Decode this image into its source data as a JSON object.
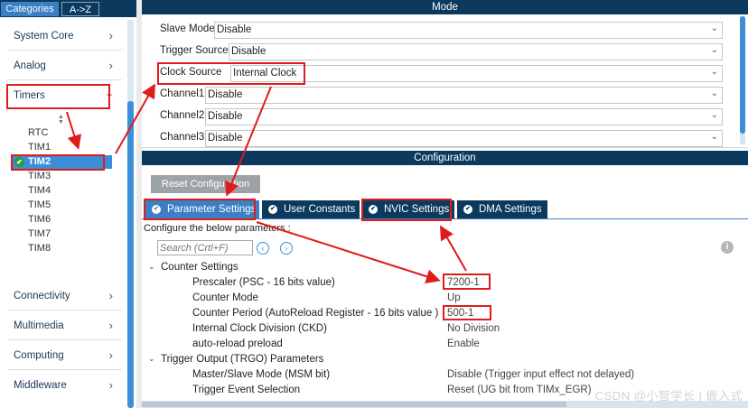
{
  "categories_tabs": {
    "active": "Categories",
    "other": "A->Z"
  },
  "categories": [
    {
      "label": "System Core",
      "expanded": false
    },
    {
      "label": "Analog",
      "expanded": false
    },
    {
      "label": "Timers",
      "expanded": true
    },
    {
      "label": "Connectivity",
      "expanded": false
    },
    {
      "label": "Multimedia",
      "expanded": false
    },
    {
      "label": "Computing",
      "expanded": false
    },
    {
      "label": "Middleware",
      "expanded": false
    }
  ],
  "timers": [
    "RTC",
    "TIM1",
    "TIM2",
    "TIM3",
    "TIM4",
    "TIM5",
    "TIM6",
    "TIM7",
    "TIM8"
  ],
  "selected_timer": "TIM2",
  "mode": {
    "title": "Mode",
    "rows": [
      {
        "label": "Slave Mode",
        "value": "Disable"
      },
      {
        "label": "Trigger Source",
        "value": "Disable"
      },
      {
        "label": "Clock Source",
        "value": "Internal Clock"
      },
      {
        "label": "Channel1",
        "value": "Disable"
      },
      {
        "label": "Channel2",
        "value": "Disable"
      },
      {
        "label": "Channel3",
        "value": "Disable"
      }
    ]
  },
  "configuration": {
    "title": "Configuration",
    "reset_label": "Reset Configuration",
    "tabs": [
      {
        "label": "Parameter Settings",
        "active": true
      },
      {
        "label": "User Constants",
        "active": false
      },
      {
        "label": "NVIC Settings",
        "active": false
      },
      {
        "label": "DMA Settings",
        "active": false
      }
    ],
    "description": "Configure the below parameters :",
    "search_placeholder": "Search (Crtl+F)",
    "params": [
      {
        "type": "group",
        "name": "Counter Settings"
      },
      {
        "type": "leaf",
        "name": "Prescaler (PSC - 16 bits value)",
        "value": "7200-1"
      },
      {
        "type": "leaf",
        "name": "Counter Mode",
        "value": "Up"
      },
      {
        "type": "leaf",
        "name": "Counter Period (AutoReload Register - 16 bits value )",
        "value": "500-1"
      },
      {
        "type": "leaf",
        "name": "Internal Clock Division (CKD)",
        "value": "No Division"
      },
      {
        "type": "leaf",
        "name": "auto-reload preload",
        "value": "Enable"
      },
      {
        "type": "group",
        "name": "Trigger Output (TRGO) Parameters"
      },
      {
        "type": "leaf",
        "name": "Master/Slave Mode (MSM bit)",
        "value": "Disable (Trigger input effect not delayed)"
      },
      {
        "type": "leaf",
        "name": "Trigger Event Selection",
        "value": "Reset (UG bit from TIMx_EGR)"
      }
    ]
  },
  "watermark": "CSDN @小智学长 | 嵌入式",
  "colors": {
    "navy": "#0b3a5e",
    "accent": "#3b8ed8",
    "annotation": "#e01b1b",
    "ok_green": "#2e9a3c"
  }
}
